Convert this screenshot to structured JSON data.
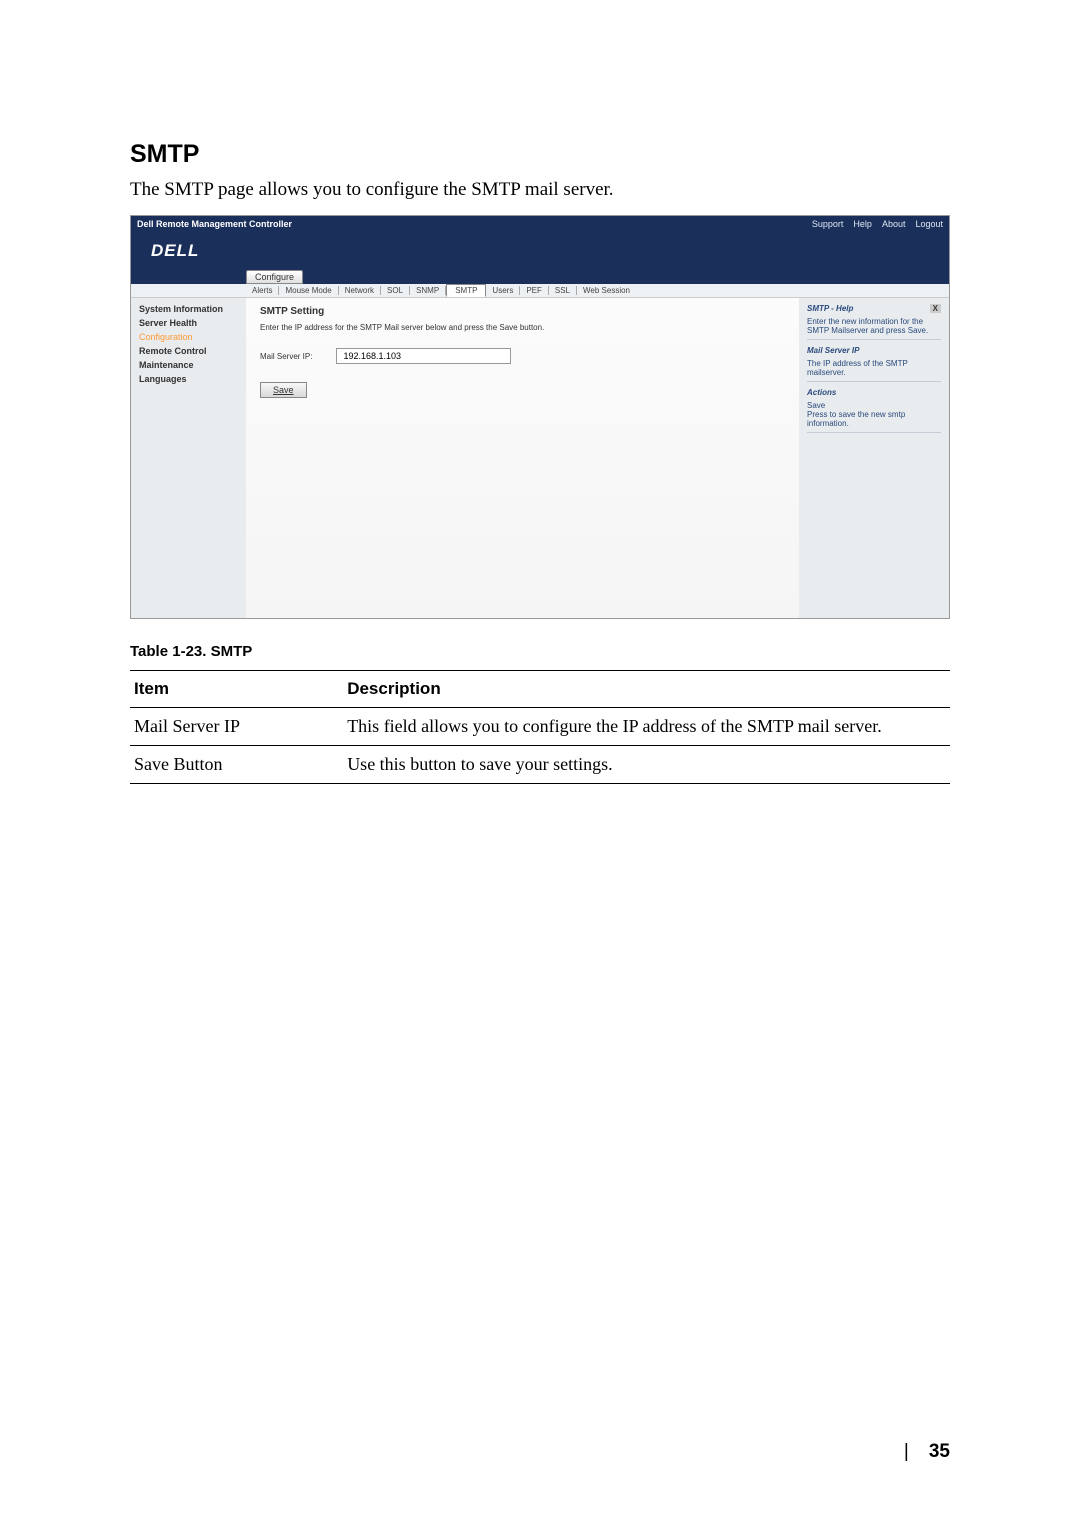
{
  "heading": "SMTP",
  "intro": "The SMTP page allows you to configure the SMTP mail server.",
  "screenshot": {
    "titlebar": "Dell Remote Management Controller",
    "toplinks": [
      "Support",
      "Help",
      "About",
      "Logout"
    ],
    "logo": "DELL",
    "configure_btn": "Configure",
    "tabs": [
      "Alerts",
      "Mouse Mode",
      "Network",
      "SOL",
      "SNMP",
      "SMTP",
      "Users",
      "PEF",
      "SSL",
      "Web Session"
    ],
    "active_tab": "SMTP",
    "sidebar": {
      "items": [
        {
          "label": "System Information",
          "bold": true
        },
        {
          "label": "Server Health",
          "bold": true
        },
        {
          "label": "Configuration",
          "active": true
        },
        {
          "label": "Remote Control",
          "bold": true
        },
        {
          "label": "Maintenance",
          "bold": true
        },
        {
          "label": "Languages",
          "bold": true
        }
      ]
    },
    "main": {
      "title": "SMTP Setting",
      "subtitle": "Enter the IP address for the SMTP Mail server below and press the Save button.",
      "field_label": "Mail Server IP:",
      "field_value": "192.168.1.103",
      "save_label": "Save"
    },
    "help": {
      "title": "SMTP - Help",
      "x": "X",
      "p1": "Enter the new information for the SMTP Mailserver and press Save.",
      "sec1": "Mail Server IP",
      "p2": "The IP address of the SMTP mailserver.",
      "sec2": "Actions",
      "p3a": "Save",
      "p3b": "Press to save the new smtp information."
    }
  },
  "table": {
    "caption": "Table 1-23.   SMTP",
    "headers": [
      "Item",
      "Description"
    ],
    "rows": [
      {
        "item": "Mail Server IP",
        "desc": "This field allows you to configure the IP address of the SMTP mail server."
      },
      {
        "item": "Save Button",
        "desc": "Use this button to save your settings."
      }
    ]
  },
  "page_number": "35"
}
